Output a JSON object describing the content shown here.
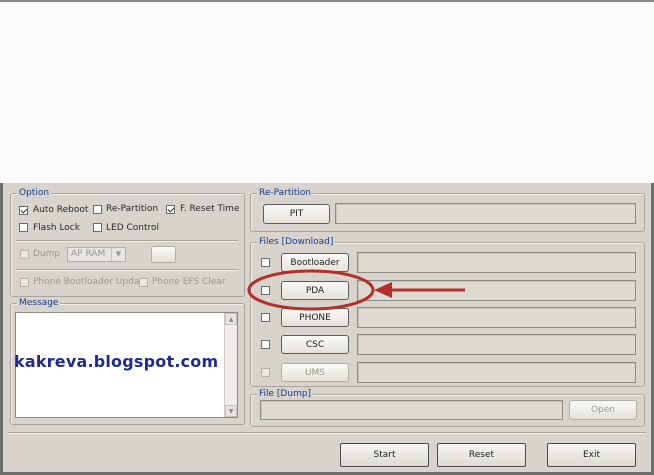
{
  "option": {
    "legend": "Option",
    "auto_reboot": {
      "label": "Auto Reboot",
      "checked": true
    },
    "re_partition": {
      "label": "Re-Partition",
      "checked": false
    },
    "f_reset_time": {
      "label": "F. Reset Time",
      "checked": true
    },
    "flash_lock": {
      "label": "Flash Lock",
      "checked": false
    },
    "led_control": {
      "label": "LED Control",
      "checked": false
    },
    "dump": {
      "label": "Dump",
      "checked": false
    },
    "dump_select": "AP RAM",
    "phone_bootloader_update": {
      "label": "Phone Bootloader Update",
      "checked": false
    },
    "phone_efs_clear": {
      "label": "Phone EFS Clear",
      "checked": false
    }
  },
  "message": {
    "legend": "Message"
  },
  "watermark": "kakreva.blogspot.com",
  "repartition": {
    "legend": "Re-Partition",
    "pit_label": "PIT"
  },
  "files": {
    "legend": "Files [Download]",
    "bootloader_label": "Bootloader",
    "pda_label": "PDA",
    "phone_label": "PHONE",
    "csc_label": "CSC",
    "ums_label": "UMS"
  },
  "file_dump": {
    "legend": "File [Dump]",
    "open_label": "Open"
  },
  "actions": {
    "start_label": "Start",
    "reset_label": "Reset",
    "exit_label": "Exit"
  },
  "annotation": {
    "highlight_color": "#b3312a"
  }
}
